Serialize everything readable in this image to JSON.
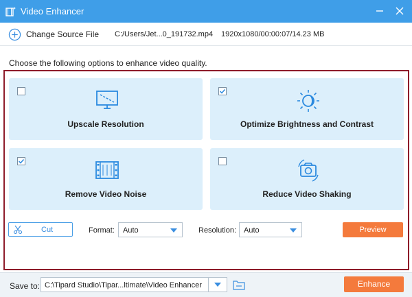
{
  "window": {
    "title": "Video Enhancer",
    "icons": {
      "app": "film-enhance-icon",
      "minimize": "minimize-icon",
      "close": "close-icon"
    }
  },
  "source": {
    "change_label": "Change Source File",
    "file_path": "C:/Users/Jet...0_191732.mp4",
    "file_info": "1920x1080/00:00:07/14.23 MB"
  },
  "main": {
    "instruction": "Choose the following options to enhance video quality.",
    "options": [
      {
        "label": "Upscale Resolution",
        "checked": false,
        "icon": "monitor-upscale-icon"
      },
      {
        "label": "Optimize Brightness and Contrast",
        "checked": true,
        "icon": "brightness-sun-icon"
      },
      {
        "label": "Remove Video Noise",
        "checked": true,
        "icon": "film-strip-icon"
      },
      {
        "label": "Reduce Video Shaking",
        "checked": false,
        "icon": "camera-stabilize-icon"
      }
    ]
  },
  "toolbar": {
    "cut_label": "Cut",
    "format_label": "Format:",
    "format_value": "Auto",
    "resolution_label": "Resolution:",
    "resolution_value": "Auto",
    "preview_label": "Preview"
  },
  "footer": {
    "save_label": "Save to:",
    "save_path": "C:\\Tipard Studio\\Tipar...ltimate\\Video Enhancer",
    "enhance_label": "Enhance"
  },
  "colors": {
    "title_bar": "#3f9ee8",
    "accent_blue": "#3a8ee0",
    "option_bg": "#dceffb",
    "frame": "#8e1b2a",
    "action_orange": "#f47a3c"
  }
}
